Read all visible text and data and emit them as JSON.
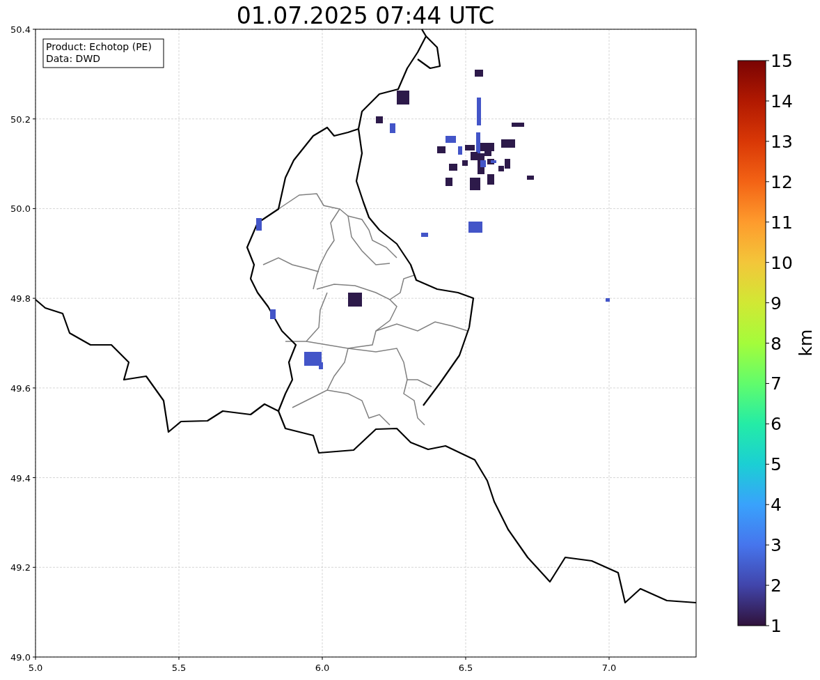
{
  "title": "01.07.2025 07:44 UTC",
  "info_box": {
    "lines": [
      "Product: Echotop (PE)",
      "Data: DWD"
    ]
  },
  "x_axis": {
    "ticks": [
      "5.0",
      "5.5",
      "6.0",
      "6.5",
      "7.0"
    ]
  },
  "y_axis": {
    "ticks": [
      "50.4",
      "50.2",
      "50.0",
      "49.8",
      "49.6",
      "49.4",
      "49.2",
      "49.0"
    ]
  },
  "colorbar": {
    "label": "km",
    "ticks": [
      "15",
      "14",
      "13",
      "12",
      "11",
      "10",
      "9",
      "8",
      "7",
      "6",
      "5",
      "4",
      "3",
      "2",
      "1"
    ]
  }
}
